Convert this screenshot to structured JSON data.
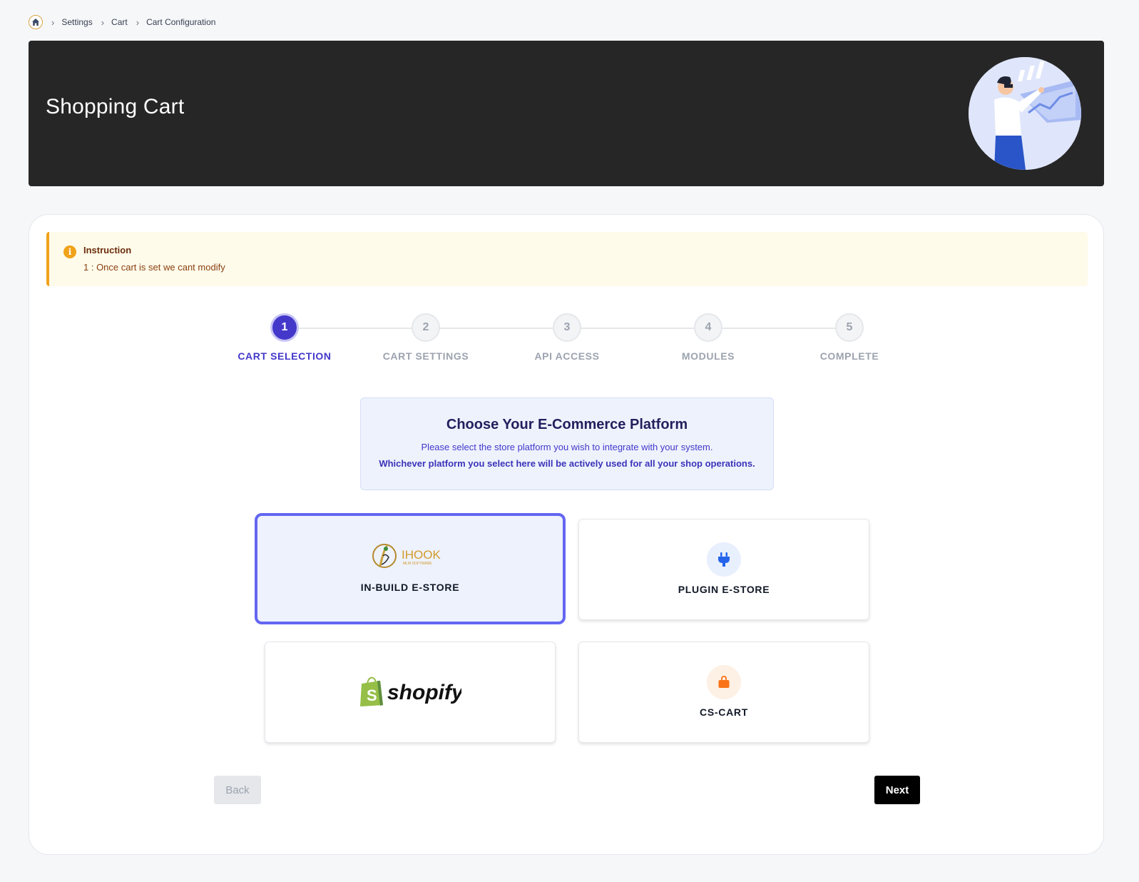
{
  "breadcrumb": {
    "home_icon": "home-icon",
    "items": [
      "Settings",
      "Cart",
      "Cart Configuration"
    ]
  },
  "banner": {
    "title": "Shopping Cart",
    "background": "#262626"
  },
  "instruction": {
    "title": "Instruction",
    "text": "1 : Once cart is set we cant modify",
    "accent": "#f0a21a"
  },
  "stepper": {
    "active_index": 0,
    "active_color": "#4338ca",
    "steps": [
      {
        "number": "1",
        "label": "CART SELECTION"
      },
      {
        "number": "2",
        "label": "CART SETTINGS"
      },
      {
        "number": "3",
        "label": "API ACCESS"
      },
      {
        "number": "4",
        "label": "MODULES"
      },
      {
        "number": "5",
        "label": "COMPLETE"
      }
    ]
  },
  "intro": {
    "title": "Choose Your E-Commerce Platform",
    "subtitle": "Please select the store platform you wish to integrate with your system.",
    "emphasis": "Whichever platform you select here will be actively used for all your shop operations."
  },
  "options": {
    "inbuild": {
      "label": "IN-BUILD E-STORE",
      "logo_text": "IHOOK",
      "logo_subtext": "MLM SOFTWARE",
      "selected": true
    },
    "plugin": {
      "label": "PLUGIN E-STORE",
      "icon": "plug-icon"
    },
    "shopify": {
      "logo_text": "shopify",
      "icon": "shopify-bag-icon"
    },
    "cscart": {
      "label": "CS-CART",
      "icon": "shopping-bag-icon"
    }
  },
  "buttons": {
    "back": "Back",
    "next": "Next"
  }
}
